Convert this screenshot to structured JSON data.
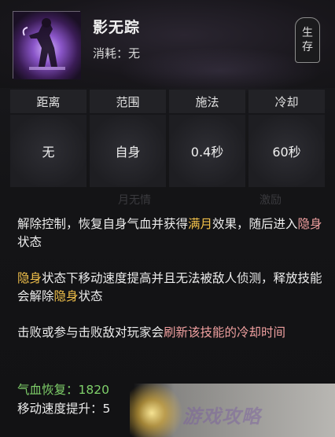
{
  "skill": {
    "name": "影无踪",
    "cost_label": "消耗：",
    "cost_value": "无",
    "tag_chars": [
      "生",
      "存"
    ]
  },
  "stats": [
    {
      "label": "距离",
      "value": "无"
    },
    {
      "label": "范围",
      "value": "自身"
    },
    {
      "label": "施法",
      "value": "0.4秒"
    },
    {
      "label": "冷却",
      "value": "60秒"
    }
  ],
  "ghost_text": [
    "月无情",
    "激励"
  ],
  "description": {
    "p1": [
      {
        "t": "解除控制，恢复自身气血并获得",
        "hl": false
      },
      {
        "t": "满月",
        "hl": true
      },
      {
        "t": "效果，随后进入",
        "hl": false
      },
      {
        "t": "隐身",
        "hl": true
      },
      {
        "t": "状态",
        "hl": false
      }
    ],
    "p2": [
      {
        "t": "隐身",
        "hl": true
      },
      {
        "t": "状态下移动速度提高并且无法被敌人侦测，释放技能会解除",
        "hl": false
      },
      {
        "t": "隐身",
        "hl": true
      },
      {
        "t": "状态",
        "hl": false
      }
    ],
    "p3": [
      {
        "t": "击败或参与击败敌对玩家会",
        "hl": false
      },
      {
        "t": "刷新该技能的冷却时间",
        "hl": true
      }
    ]
  },
  "effects": [
    {
      "label": "气血恢复：",
      "value": "1820"
    },
    {
      "label": "移动速度提升：",
      "value": "5"
    }
  ],
  "watermark_text": "游戏攻略",
  "colors": {
    "highlight": "#f1c04a",
    "effect_label": "#7fd06a"
  }
}
